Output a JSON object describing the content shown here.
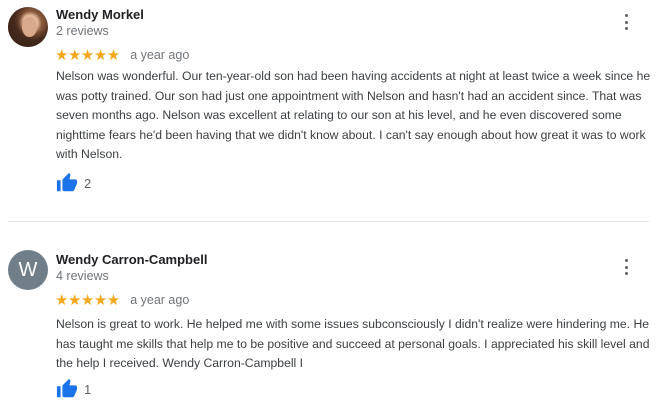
{
  "reviews": [
    {
      "author": "Wendy Morkel",
      "review_count": "2 reviews",
      "avatar": {
        "type": "photo"
      },
      "stars": "★★★★★",
      "rating": 5,
      "date": "a year ago",
      "text": "Nelson was wonderful. Our ten-year-old son had been having accidents at night at least twice a week since he was potty trained. Our son had just one appointment with Nelson and hasn't had an accident since. That was seven months ago. Nelson was excellent at relating to our son at his level, and he even discovered some nighttime fears he'd been having that we didn't know about. I can't say enough about how great it was to work with Nelson.",
      "likes": "2",
      "like_icon": "thumbs-up-icon",
      "menu_icon": "more-vertical-icon"
    },
    {
      "author": "Wendy Carron-Campbell",
      "review_count": "4 reviews",
      "avatar": {
        "type": "letter",
        "letter": "W",
        "color": "#6f7e89"
      },
      "stars": "★★★★★",
      "rating": 5,
      "date": "a year ago",
      "text": "Nelson is great to work.  He helped me with some issues subconsciously I didn't realize were hindering me.   He has  taught me skills that help me to be positive and succeed at personal goals.  I appreciated his skill level and the help I received.  Wendy Carron-Campbell I",
      "likes": "1",
      "like_icon": "thumbs-up-icon",
      "menu_icon": "more-vertical-icon"
    }
  ],
  "colors": {
    "star": "#f4a81d",
    "like_icon": "#1a73e8",
    "name": "#202124",
    "secondary_text": "#70757a",
    "body_text": "#3c4043"
  }
}
